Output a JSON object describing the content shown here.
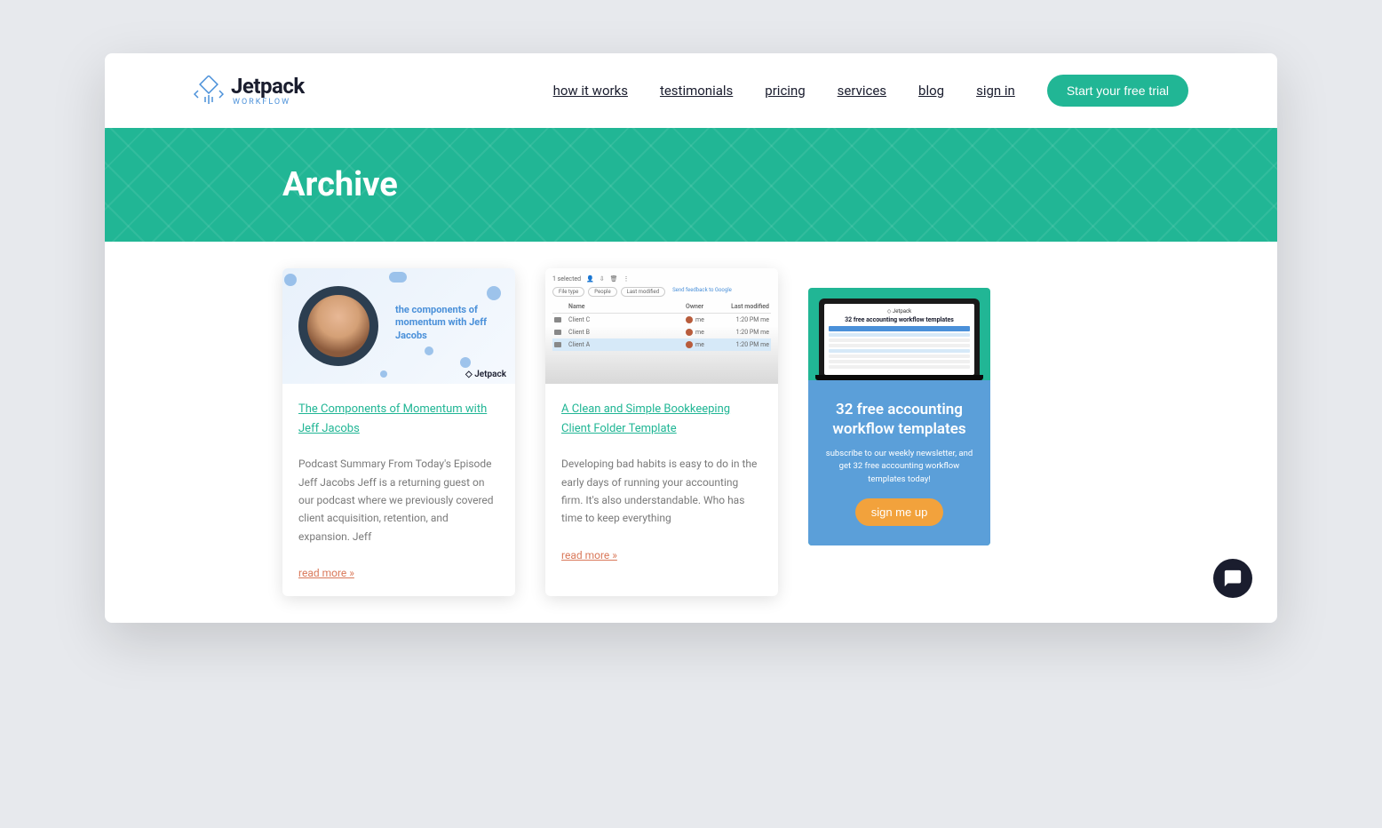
{
  "brand": {
    "name": "Jetpack",
    "tagline": "Workflow"
  },
  "nav": {
    "items": [
      {
        "label": "how it works"
      },
      {
        "label": "testimonials"
      },
      {
        "label": "pricing"
      },
      {
        "label": "services"
      },
      {
        "label": "blog"
      },
      {
        "label": "sign in"
      }
    ],
    "cta": "Start your free trial"
  },
  "hero": {
    "title": "Archive"
  },
  "posts": [
    {
      "title": "The Components of Momentum with Jeff Jacobs",
      "excerpt": "Podcast Summary From Today's Episode Jeff Jacobs Jeff is a returning guest on our podcast where we previously covered client acquisition, retention, and expansion. Jeff",
      "thumb_text": "the components of momentum with Jeff Jacobs",
      "thumb_brand": "Jetpack",
      "read_more": "read more »"
    },
    {
      "title": "A Clean and Simple Bookkeeping Client Folder Template",
      "excerpt": "Developing bad habits is easy to do in the early days of running your accounting firm. It's also understandable. Who has time to keep everything",
      "read_more": "read more »",
      "thumb_table": {
        "selected_count": "1 selected",
        "filters": [
          "File type",
          "People",
          "Last modified"
        ],
        "link": "Send feedback to Google",
        "columns": [
          "Name",
          "Owner",
          "Last modified"
        ],
        "rows": [
          {
            "name": "Client C",
            "owner": "me",
            "date": "1:20 PM me"
          },
          {
            "name": "Client B",
            "owner": "me",
            "date": "1:20 PM me"
          },
          {
            "name": "Client A",
            "owner": "me",
            "date": "1:20 PM me",
            "selected": true
          }
        ]
      }
    }
  ],
  "sidebar": {
    "laptop_brand": "Jetpack",
    "laptop_title": "32 free accounting workflow templates",
    "heading": "32 free accounting workflow templates",
    "sub": "subscribe to our weekly newsletter, and get 32 free accounting workflow templates today!",
    "button": "sign me up"
  }
}
